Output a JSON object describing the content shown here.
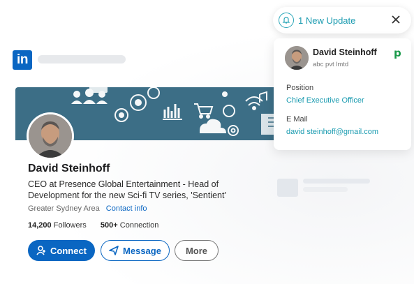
{
  "header": {
    "logo_text": "in"
  },
  "profile": {
    "name": "David Steinhoff",
    "headline": "CEO at Presence Global Entertainment - Head of Development for the new Sci-fi TV series, 'Sentient'",
    "location": "Greater Sydney Area",
    "contact_info_link": "Contact info",
    "followers_count": "14,200",
    "followers_label": "Followers",
    "connections_count": "500+",
    "connections_label": "Connection",
    "buttons": {
      "connect": "Connect",
      "message": "Message",
      "more": "More"
    }
  },
  "notification": {
    "text": "1 New Update"
  },
  "contact_card": {
    "name": "David Steinhoff",
    "company": "abc pvt lmtd",
    "brand_glyph": "p",
    "position_label": "Position",
    "position_value": "Chief Executive Officer",
    "email_label": "E Mail",
    "email_value": "david steinhoff@gmail.com"
  },
  "colors": {
    "linkedin_blue": "#0a66c2",
    "banner": "#3c6e86",
    "teal_accent": "#1a9bb0",
    "brand_green": "#1a9a4a"
  }
}
